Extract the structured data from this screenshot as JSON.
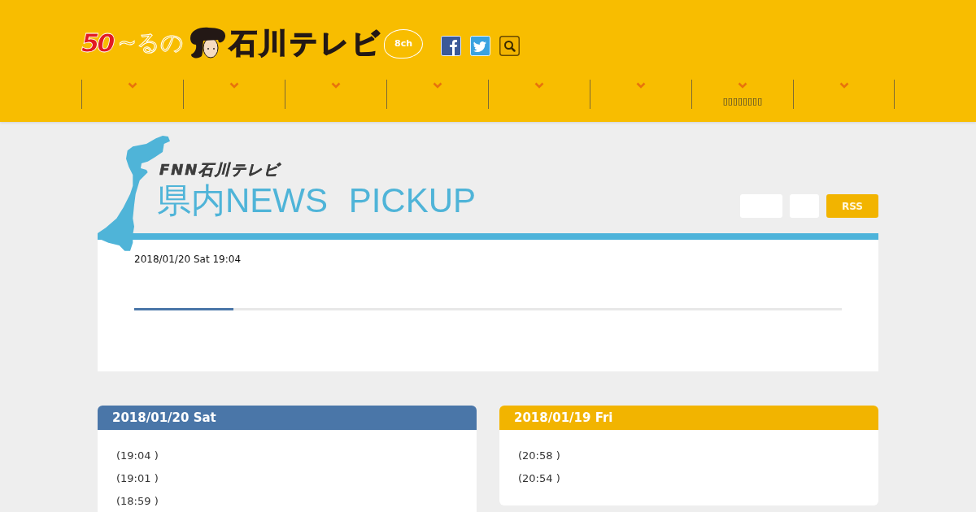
{
  "header": {
    "logo": {
      "anniversary": "50",
      "tagline": "~るの",
      "name": "石川テレビ",
      "channel": "8ch"
    },
    "social": [
      {
        "kind": "facebook"
      },
      {
        "kind": "twitter"
      },
      {
        "kind": "search"
      }
    ],
    "nav": [
      {
        "kind": "blank"
      },
      {
        "kind": "blank"
      },
      {
        "kind": "blank"
      },
      {
        "kind": "blank"
      },
      {
        "kind": "blank"
      },
      {
        "kind": "blank"
      },
      {
        "kind": "labelled",
        "label": "▯▯▯▯▯▯▯▯"
      },
      {
        "kind": "blank"
      }
    ]
  },
  "pickup": {
    "source": "FNN石川テレビ",
    "title": "県内NEWS PICKUP",
    "buttons": [
      {
        "kind": "blank"
      },
      {
        "kind": "blank"
      },
      {
        "kind": "text",
        "label": "RSS"
      }
    ],
    "featured": {
      "timestamp": "2018/01/20 Sat 19:04",
      "level": 0.14
    }
  },
  "days": [
    {
      "date": "2018/01/20 Sat",
      "color": "#4a76a8",
      "items": [
        "(19:04 )",
        "(19:01 )",
        "(18:59 )"
      ]
    },
    {
      "date": "2018/01/19 Fri",
      "color": "#f2b400",
      "items": [
        "(20:58 )",
        "(20:54 )"
      ]
    }
  ]
}
